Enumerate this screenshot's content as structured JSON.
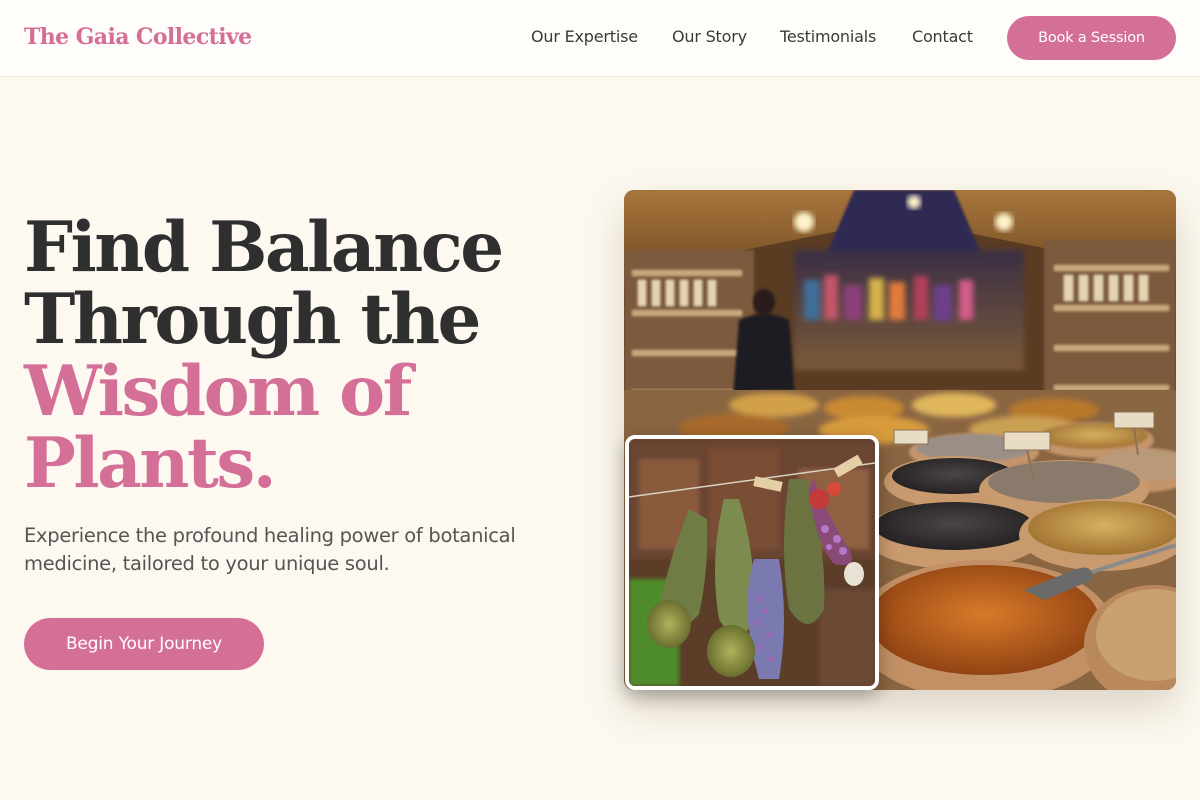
{
  "brand": {
    "name": "The Gaia Collective",
    "accent_color": "#d46f97"
  },
  "nav": {
    "items": [
      {
        "label": "Our Expertise"
      },
      {
        "label": "Our Story"
      },
      {
        "label": "Testimonials"
      },
      {
        "label": "Contact"
      }
    ],
    "cta_label": "Book a Session"
  },
  "hero": {
    "title_line1": "Find Balance",
    "title_line2": "Through the",
    "title_line3": "Wisdom of",
    "title_line4": "Plants.",
    "subtitle": "Experience the profound healing power of botanical medicine, tailored to your unique soul.",
    "cta_label": "Begin Your Journey"
  },
  "images": {
    "main": {
      "subject": "spice-market-photo"
    },
    "inset": {
      "subject": "dried-herbs-photo"
    }
  }
}
